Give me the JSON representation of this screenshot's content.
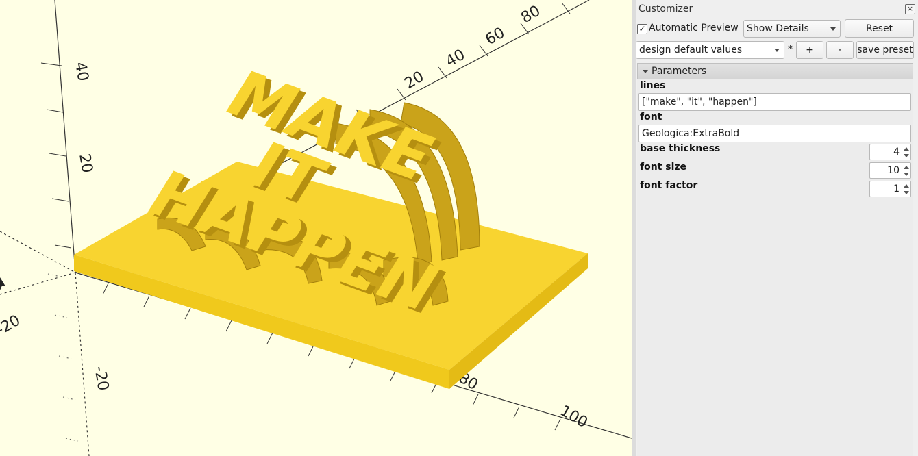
{
  "viewport": {
    "axis_numbers": {
      "y_40": "40",
      "y_20": "20",
      "y_neg20": "-20",
      "x_80": "80",
      "x_60": "60",
      "x_40": "40",
      "x_20": "20",
      "x_100": "100",
      "x_80b": "80",
      "x_neg20": "-20"
    },
    "model_text": [
      "MAKE",
      "IT",
      "HAPPEN"
    ],
    "colors": {
      "background": "#ffffe5",
      "model": "#f8d430",
      "model_shadow": "#b58f10"
    }
  },
  "customizer": {
    "title": "Customizer",
    "close_icon": "close-icon",
    "automatic_preview": {
      "label": "Automatic Preview",
      "checked": true,
      "check_glyph": "✓"
    },
    "details_combo": "Show Details",
    "reset_button": "Reset",
    "preset_combo": "design default values",
    "preset_modified": "*",
    "add_preset_button": "+",
    "remove_preset_button": "-",
    "save_preset_button": "save preset",
    "group": "Parameters",
    "params": {
      "lines": {
        "label": "lines",
        "value": "[\"make\", \"it\", \"happen\"]"
      },
      "font": {
        "label": "font",
        "value": "Geologica:ExtraBold"
      },
      "base_thickness": {
        "label": "base thickness",
        "value": "4"
      },
      "font_size": {
        "label": "font size",
        "value": "10"
      },
      "font_factor": {
        "label": "font factor",
        "value": "1"
      }
    }
  }
}
